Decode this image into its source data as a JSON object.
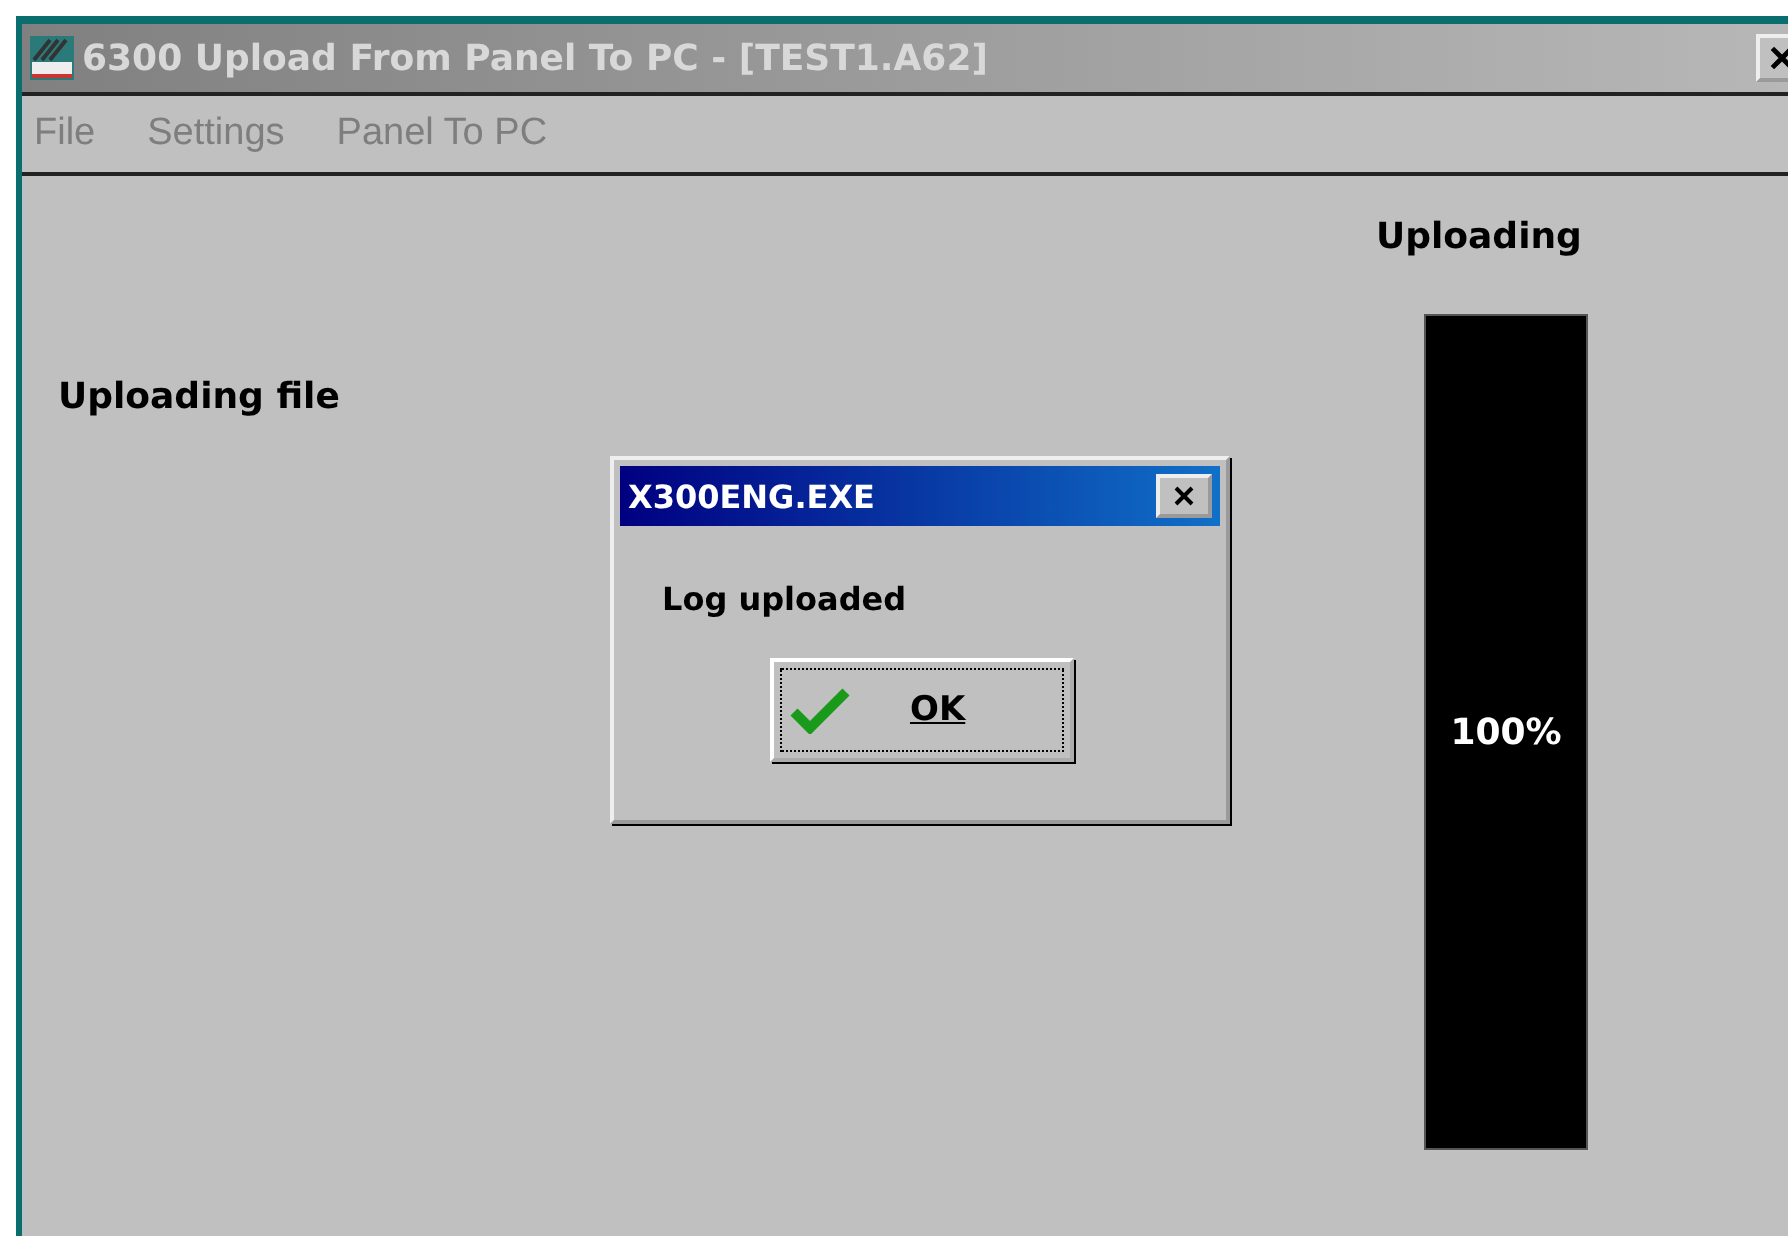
{
  "window": {
    "title": "6300 Upload From Panel To PC - [TEST1.A62]",
    "active": false
  },
  "menu": [
    {
      "label": "File",
      "disabled": true
    },
    {
      "label": "Settings",
      "disabled": true
    },
    {
      "label": "Panel To PC",
      "disabled": true
    }
  ],
  "status_label": "Uploading file",
  "progress": {
    "title": "Uploading",
    "level": 1,
    "reading": "100%"
  },
  "dialog": {
    "title": "X300ENG.EXE",
    "active": true,
    "message": "Log uploaded",
    "button": "OK"
  }
}
